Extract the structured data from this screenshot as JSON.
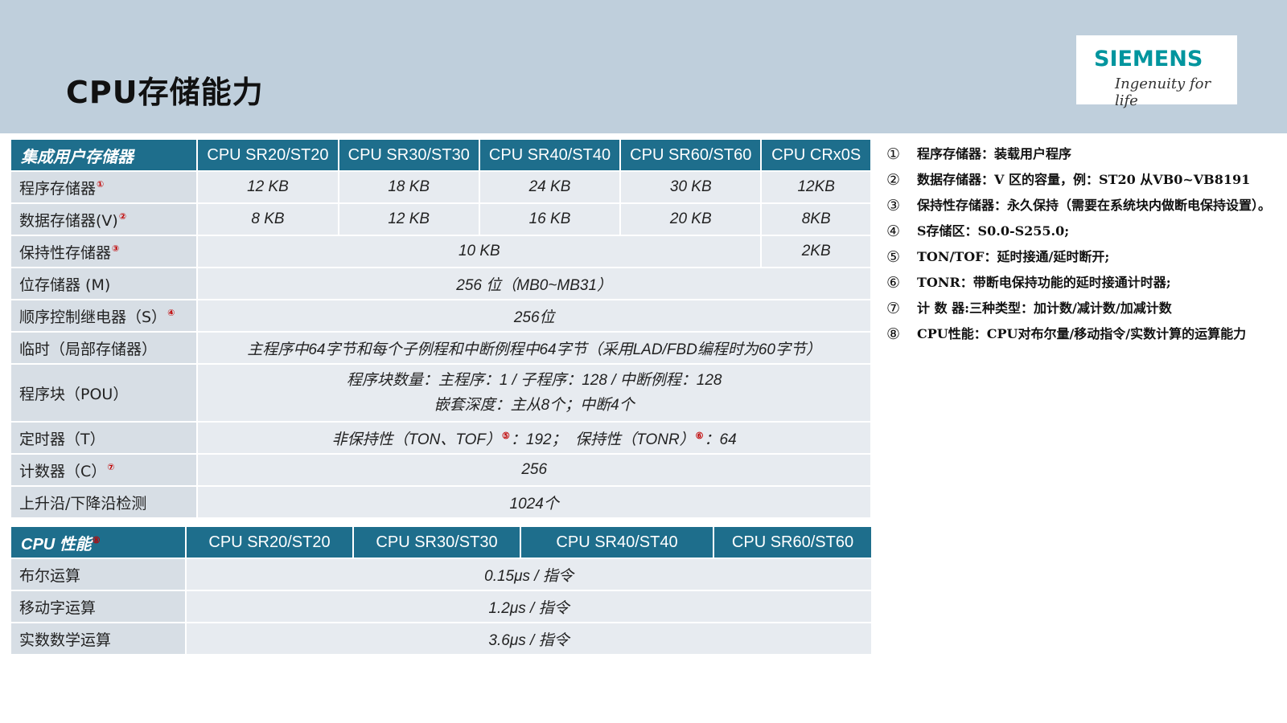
{
  "header": {
    "title": "CPU存储能力",
    "logo_word": "SIEMENS",
    "logo_tagline": "Ingenuity for life"
  },
  "memory_table": {
    "header": [
      "集成用户存储器",
      "CPU SR20/ST20",
      "CPU SR30/ST30",
      "CPU SR40/ST40",
      "CPU SR60/ST60",
      "CPU CRx0S"
    ],
    "program_memory": {
      "label": "程序存储器",
      "mark": "①",
      "values": [
        "12 KB",
        "18 KB",
        "24 KB",
        "30 KB",
        "12KB"
      ]
    },
    "data_memory": {
      "label": "数据存储器(V)",
      "mark": "②",
      "values": [
        "8 KB",
        "12 KB",
        "16 KB",
        "20 KB",
        "8KB"
      ]
    },
    "retentive_memory": {
      "label": "保持性存储器",
      "mark": "③",
      "value_main": "10 KB",
      "value_crx": "2KB"
    },
    "bit_memory": {
      "label": "位存储器 (M)",
      "value": "256 位（MB0~MB31）"
    },
    "sequence_relay": {
      "label": "顺序控制继电器（S）",
      "mark": "④",
      "value": "256位"
    },
    "temp_memory": {
      "label": "临时（局部存储器）",
      "value": "主程序中64字节和每个子例程和中断例程中64字节（采用LAD/FBD编程时为60字节）"
    },
    "program_blocks": {
      "label": "程序块（POU）",
      "line1": "程序块数量：主程序：1 / 子程序：128 / 中断例程：128",
      "line2": "嵌套深度：主从8个；中断4个"
    },
    "timers": {
      "label": "定时器（T）",
      "part1": "非保持性（TON、TOF）",
      "mark1": "⑤",
      "part2": "：192；  保持性（TONR）",
      "mark2": "⑥",
      "part3": "：64"
    },
    "counters": {
      "label": "计数器（C）",
      "mark": "⑦",
      "value": "256"
    },
    "edge_detect": {
      "label": "上升沿/下降沿检测",
      "value": "1024个"
    }
  },
  "performance_table": {
    "header": [
      "CPU 性能",
      "CPU SR20/ST20",
      "CPU SR30/ST30",
      "CPU SR40/ST40",
      "CPU SR60/ST60"
    ],
    "header_mark": "⑧",
    "rows": [
      {
        "label": "布尔运算",
        "value": "0.15μs / 指令"
      },
      {
        "label": "移动字运算",
        "value": "1.2μs / 指令"
      },
      {
        "label": "实数数学运算",
        "value": "3.6μs / 指令"
      }
    ]
  },
  "notes": [
    {
      "num": "①",
      "text": "程序存储器：装载用户程序"
    },
    {
      "num": "②",
      "text": "数据存储器：V 区的容量，例：ST20 从VB0~VB8191"
    },
    {
      "num": "③",
      "text": "保持性存储器：永久保持（需要在系统块内做断电保持设置）。"
    },
    {
      "num": "④",
      "text": "S存储区：S0.0-S255.0;"
    },
    {
      "num": "⑤",
      "text": "TON/TOF：延时接通/延时断开;"
    },
    {
      "num": "⑥",
      "text": "TONR：带断电保持功能的延时接通计时器;"
    },
    {
      "num": "⑦",
      "text": "计 数 器:三种类型：加计数/减计数/加减计数"
    },
    {
      "num": "⑧",
      "text": "CPU性能：CPU对布尔量/移动指令/实数计算的运算能力"
    }
  ]
}
